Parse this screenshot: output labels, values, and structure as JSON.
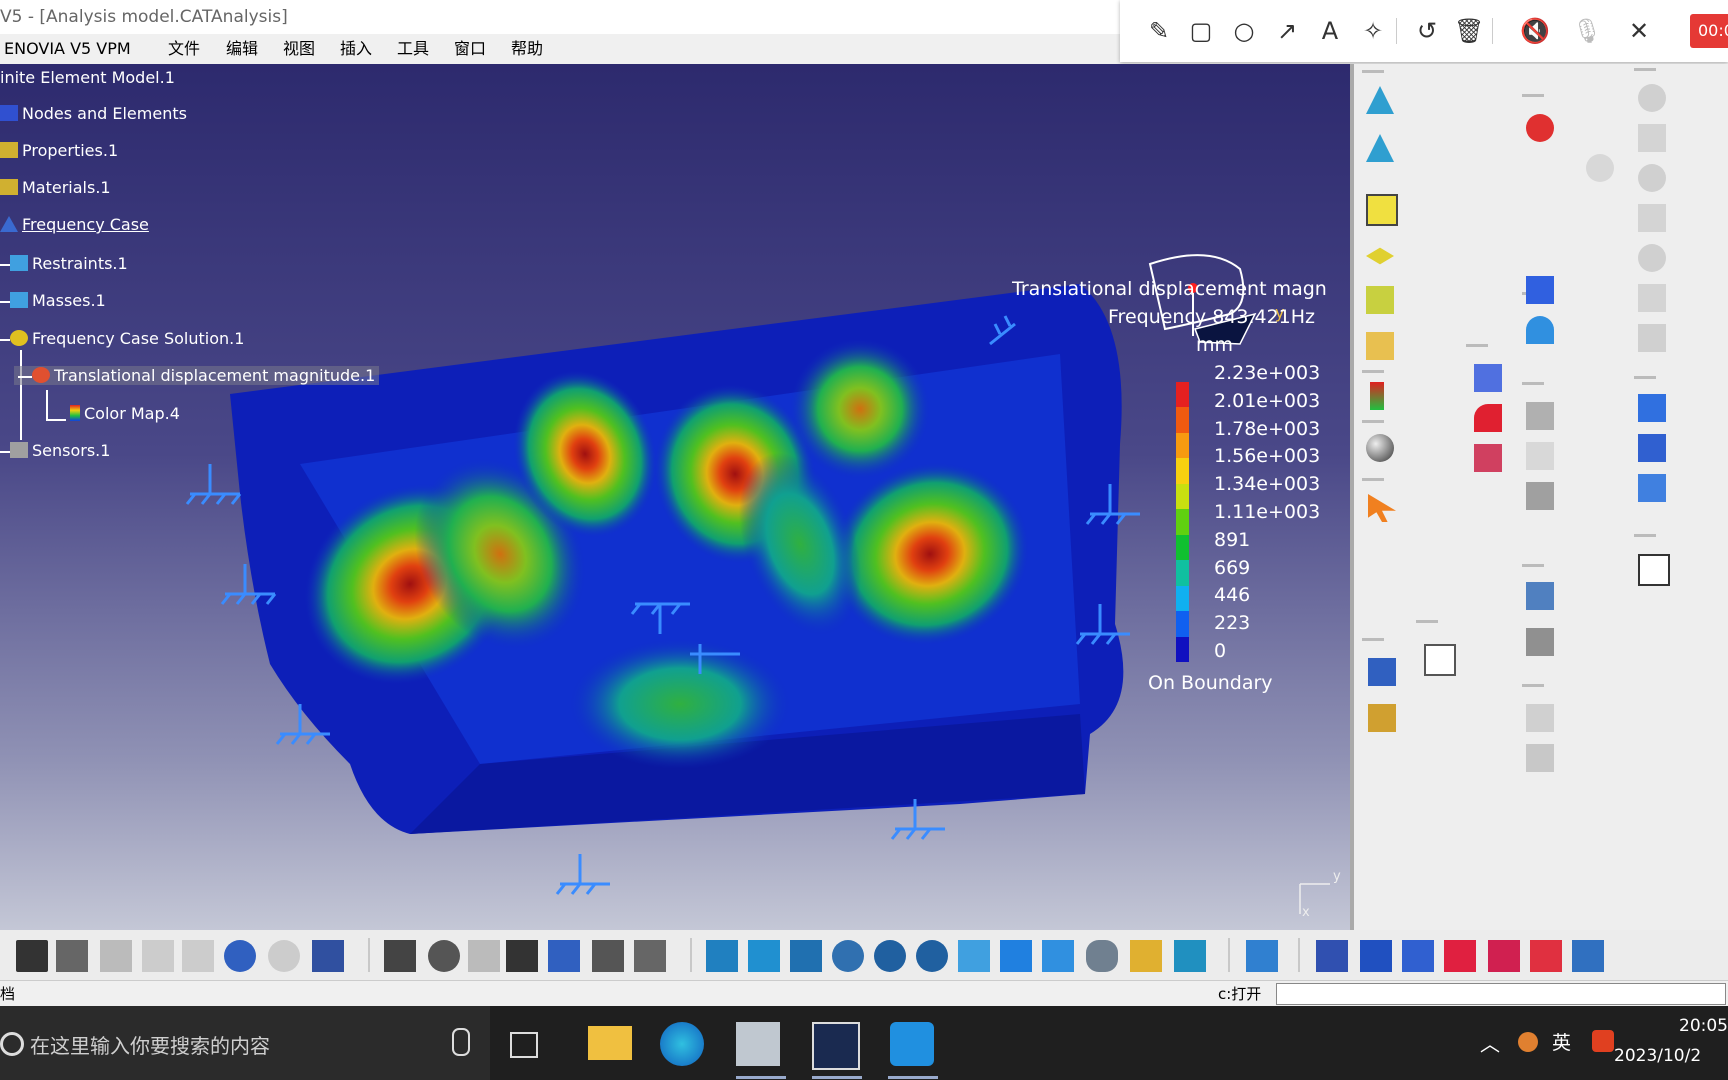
{
  "window": {
    "title": "V5 - [Analysis model.CATAnalysis]"
  },
  "menu": [
    "ENOVIA V5 VPM",
    "文件",
    "编辑",
    "视图",
    "插入",
    "工具",
    "窗口",
    "帮助"
  ],
  "recorder": {
    "timer": "00:0"
  },
  "tree": {
    "root": "inite Element Model.1",
    "nodes": [
      "Nodes and Elements",
      "Properties.1",
      "Materials.1",
      "Frequency Case",
      "Restraints.1",
      "Masses.1",
      "Frequency Case Solution.1",
      "Translational displacement magnitude.1",
      "Color Map.4",
      "Sensors.1"
    ]
  },
  "legend": {
    "title": "Translational displacement magn",
    "frequency": "Frequency 843.421Hz",
    "unit": "mm",
    "values": [
      "2.23e+003",
      "2.01e+003",
      "1.78e+003",
      "1.56e+003",
      "1.34e+003",
      "1.11e+003",
      "891",
      "669",
      "446",
      "223",
      "0"
    ],
    "footer": "On Boundary",
    "colors": [
      "#e52020",
      "#f05a10",
      "#f79a10",
      "#f7d010",
      "#c8e010",
      "#60d010",
      "#10c030",
      "#10c0a0",
      "#10b0f0",
      "#1060f0",
      "#1010c0"
    ]
  },
  "axes": {
    "y1": "y",
    "y2": "y",
    "x": "x"
  },
  "status": {
    "left": "档",
    "cmd_label": "c:打开"
  },
  "taskbar": {
    "search_placeholder": "在这里输入你要搜索的内容",
    "ime": "英",
    "time": "20:05",
    "date": "2023/10/2"
  }
}
